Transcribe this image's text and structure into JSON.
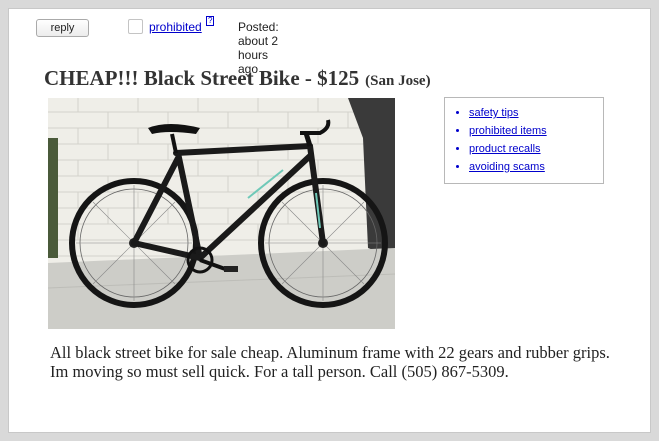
{
  "header": {
    "reply_label": "reply",
    "prohibited_label": "prohibited",
    "help_marker": "?",
    "posted_text": "Posted: about 2 hours ago"
  },
  "posting": {
    "title": "CHEAP!!! Black Street Bike - $125",
    "location": "(San Jose)",
    "body": "All black street bike for sale cheap. Aluminum frame with 22 gears and rubber grips. Im moving so must sell quick. For a tall person. Call (505) 867-5309."
  },
  "tips": {
    "items": [
      "safety tips",
      "prohibited items",
      "product recalls",
      "avoiding scams"
    ]
  },
  "photo": {
    "subject": "black street bike leaning against white brick wall"
  }
}
